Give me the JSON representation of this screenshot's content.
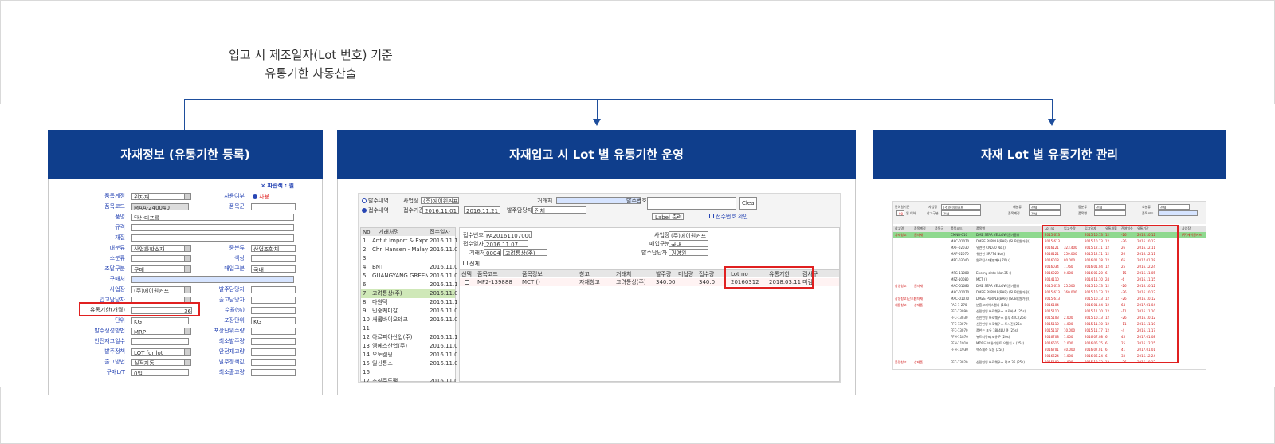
{
  "caption": {
    "line1": "입고 시 제조일자(Lot 번호) 기준",
    "line2": "유통기한 자동산출"
  },
  "panels": [
    {
      "title": "자재정보 (유통기한 등록)"
    },
    {
      "title": "자재입고 시 Lot 별 유통기한 운영"
    },
    {
      "title": "자재 Lot 별 유통기한 관리"
    }
  ],
  "material_form": {
    "top_link": "× 파란색 : 필",
    "rows": [
      {
        "label": "품목계정",
        "value": "원자재",
        "right_label": "사용여부",
        "right_value": "사용"
      },
      {
        "label": "품목코드",
        "value": "MAA-240040",
        "right_label": "품목군",
        "right_value": ""
      },
      {
        "label": "품명",
        "value": "탄산디프롤",
        "right_label": "",
        "right_value": ""
      },
      {
        "label": "규격",
        "value": "",
        "right_label": "",
        "right_value": ""
      },
      {
        "label": "재질",
        "value": "",
        "right_label": "",
        "right_value": ""
      },
      {
        "label": "대분류",
        "value": "산업화학소재",
        "right_label": "중분류",
        "right_value": "산업조합체"
      },
      {
        "label": "소분류",
        "value": "",
        "right_label": "색상",
        "right_value": ""
      },
      {
        "label": "조달구분",
        "value": "구매",
        "right_label": "매입구분",
        "right_value": "국내"
      },
      {
        "label": "구매처",
        "value": "",
        "right_label": "",
        "right_value": ""
      },
      {
        "label": "사업장",
        "value": "(주)에이원커프",
        "right_label": "발주담당자",
        "right_value": ""
      },
      {
        "label": "입고담당자",
        "value": "",
        "right_label": "출고담당자",
        "right_value": ""
      },
      {
        "label": "유통기한(개월)",
        "value": "36",
        "right_label": "수율(%)",
        "right_value": ""
      },
      {
        "label": "단위",
        "value": "KG",
        "right_label": "포장단위",
        "right_value": "KG"
      },
      {
        "label": "발주생성방법",
        "value": "MRP",
        "right_label": "포장단위수량",
        "right_value": ""
      },
      {
        "label": "안전재고일수",
        "value": "",
        "right_label": "최소발주량",
        "right_value": ""
      },
      {
        "label": "발주정책",
        "value": "LOT for lot",
        "right_label": "안전재고량",
        "right_value": ""
      },
      {
        "label": "출고방법",
        "value": "실적자동",
        "right_label": "발주정책값",
        "right_value": ""
      },
      {
        "label": "구매L/T",
        "value": "0일",
        "right_label": "최소출고량",
        "right_value": ""
      }
    ]
  },
  "receipt_screen": {
    "filter": {
      "radio1": "발주내역",
      "radio2": "접수내역",
      "site_label": "사업장",
      "site_value": "(주)에이원커프",
      "period_label": "접수기간",
      "date_from": "2016.11.01",
      "date_to": "2016.11.21",
      "vendor_label": "거래처",
      "manager_label": "발주담당자",
      "manager_value": "전체",
      "order_no_label": "발주번호",
      "clear_button": "Clear",
      "label_button": "Label 출력",
      "confirm_check": "접수번호 확인"
    },
    "list_headers": [
      "No.",
      "거래처명",
      "접수일자"
    ],
    "list_rows": [
      {
        "no": "1",
        "name": "Anfut Import & Expo",
        "date": "2016.11.10"
      },
      {
        "no": "2",
        "name": "Chr. Hansen - Malay",
        "date": "2016.11.02"
      },
      {
        "no": "3",
        "name": "",
        "date": ""
      },
      {
        "no": "4",
        "name": "BNT",
        "date": "2016.11.02"
      },
      {
        "no": "5",
        "name": "GUANGYANG GREEN SEA",
        "date": "2016.11.01"
      },
      {
        "no": "6",
        "name": "",
        "date": "2016.11.14"
      },
      {
        "no": "7",
        "name": "고려통상(주)",
        "date": "2016.11.07"
      },
      {
        "no": "8",
        "name": "다원텍",
        "date": "2016.11.11"
      },
      {
        "no": "9",
        "name": "민중케미칼",
        "date": "2016.11.07"
      },
      {
        "no": "10",
        "name": "새롬바이오테크",
        "date": "2016.11.09"
      },
      {
        "no": "11",
        "name": "",
        "date": ""
      },
      {
        "no": "12",
        "name": "아르피아산업(주)",
        "date": "2016.11.11"
      },
      {
        "no": "13",
        "name": "엠에스산업(주)",
        "date": "2016.11.03"
      },
      {
        "no": "14",
        "name": "오토캠핑",
        "date": "2016.11.01"
      },
      {
        "no": "15",
        "name": "일신통스",
        "date": "2016.11.07"
      },
      {
        "no": "16",
        "name": "",
        "date": ""
      },
      {
        "no": "17",
        "name": "조성주도팩",
        "date": "2016.11.04"
      }
    ],
    "detail": {
      "receipt_no_label": "접수번호",
      "receipt_no": "PA2016110700001",
      "date_label": "접수일자",
      "date": "2016.11.07",
      "vendor_label": "거래처",
      "vendor_code": "00042",
      "vendor_name": "고려통상(주)",
      "site_label": "사업장",
      "site": "(주)에이원커프",
      "buy_type_label": "매입구분",
      "buy_type": "국내",
      "manager_label": "발주담당자",
      "manager": "권영원",
      "all_check": "전체"
    },
    "grid_headers": [
      "선택",
      "품목코드",
      "품목정보",
      "창고",
      "거래처",
      "발주량",
      "미납량",
      "접수량",
      "Lot no",
      "유통기한",
      "검사구"
    ],
    "grid_row": {
      "code": "MF2-139888",
      "info": "MCT ()",
      "warehouse": "자재창고",
      "vendor": "고려통상(주)",
      "order_qty": "340.00",
      "recv_qty": "340.0",
      "lot": "20160312",
      "expiry": "2018.03.11",
      "inspect": "미검"
    }
  },
  "lot_screen": {
    "filter": {
      "expiry_label": "잔여일기준",
      "expiry_value": "90",
      "expiry_suffix": "일 이하",
      "site_label": "사업장",
      "site_value": "(주)에이원커프",
      "warehouse_label": "창고구분",
      "warehouse_value": "전체",
      "acct_label": "대분류",
      "acct_value": "전체",
      "mid_label": "중분류",
      "mid_value": "전체",
      "small_label": "소분류",
      "small_value": "전체",
      "status_label": "품목계정",
      "status_value": "전체",
      "name_label": "품목명",
      "code_label": "품목코드"
    },
    "headers": [
      "창고명",
      "품목계정",
      "품목군",
      "품목코드",
      "품목명",
      "Lot no",
      "입고수량",
      "입고일자",
      "유통개월",
      "잔여일수",
      "유통기간",
      "사업장"
    ],
    "rows": [
      {
        "wh": "자재창고",
        "acct": "원자재",
        "code": "CMNB-010",
        "name": "DMZ STAR YELLOW(원가용()",
        "lot": "2015.613",
        "qty": "",
        "date": "2015.10.13",
        "mon": "12",
        "rem": "-26",
        "exp": "2016.10.12",
        "site": "(주)에이원커프",
        "hl": true
      },
      {
        "wh": "",
        "acct": "",
        "code": "MAC-01070",
        "name": "DMZE PURPLE(BAR) (SUB)(원가용()",
        "lot": "2015.613",
        "qty": "",
        "date": "2015.10.13",
        "mon": "12",
        "rem": "-26",
        "exp": "2016.10.12",
        "site": ""
      },
      {
        "wh": "",
        "acct": "",
        "code": "MAF-02030",
        "name": "유연한 CN070 No.()",
        "lot": "2016121",
        "qty": "323.400",
        "date": "2015.12.11",
        "mon": "12",
        "rem": "26",
        "exp": "2016.12.11",
        "site": ""
      },
      {
        "wh": "",
        "acct": "",
        "code": "MAF-02070",
        "name": "유연한 SR774 No.()",
        "lot": "2016121",
        "qty": "250.000",
        "date": "2015.12.11",
        "mon": "12",
        "rem": "26",
        "exp": "2016.12.11",
        "site": ""
      },
      {
        "wh": "",
        "acct": "",
        "code": "MFC-03040",
        "name": "원료팀소재(판매사 70).()",
        "lot": "2016018",
        "qty": "80.000",
        "date": "2016.01.28",
        "mon": "12",
        "rem": "65",
        "exp": "2017.01.28",
        "site": ""
      },
      {
        "wh": "",
        "acct": "",
        "code": "",
        "name": "",
        "lot": "2016034",
        "qty": "7.760",
        "date": "2016.01.04",
        "mon": "12",
        "rem": "25",
        "exp": "2016.12.24",
        "site": ""
      },
      {
        "wh": "",
        "acct": "",
        "code": "MFG-11080",
        "name": "Enerny slrde blar.35 ()",
        "lot": "2016020",
        "qty": "0.000",
        "date": "2016.05.20",
        "mon": "6",
        "rem": "-15",
        "exp": "2016.11.05",
        "site": ""
      },
      {
        "wh": "",
        "acct": "",
        "code": "MFZ-10080",
        "name": "MCT ()",
        "lot": "2014110",
        "qty": "",
        "date": "2014.11.10",
        "mon": "24",
        "rem": "-6",
        "exp": "2016.11.15",
        "site": ""
      },
      {
        "wh": "상생창고",
        "acct": "원자재",
        "code": "MAC-01080",
        "name": "DMZ STAR YELLOW(원가용()",
        "lot": "2015.613",
        "qty": "25.000",
        "date": "2015.10.13",
        "mon": "12",
        "rem": "-26",
        "exp": "2016.10.12",
        "site": ""
      },
      {
        "wh": "",
        "acct": "",
        "code": "MAC-01070",
        "name": "DMZE PURPLE(BAR) (SUB)(원가용()",
        "lot": "2015.613",
        "qty": "160.000",
        "date": "2015.10.13",
        "mon": "12",
        "rem": "-26",
        "exp": "2016.10.12",
        "site": ""
      },
      {
        "wh": "상생창고(단조)",
        "acct": "원자재",
        "code": "MAC-01070",
        "name": "DMZE PURPLE(BAR) (SUB)(원가용()",
        "lot": "2015.613",
        "qty": "",
        "date": "2015.10.13",
        "mon": "12",
        "rem": "-26",
        "exp": "2016.10.12",
        "site": ""
      },
      {
        "wh": "제품창고",
        "acct": "상제품",
        "code": "FAC-1-270",
        "name": "분홍고레이스젤리 (10s)",
        "lot": "2016104",
        "qty": "",
        "date": "2016.01.04",
        "mon": "12",
        "rem": "64",
        "exp": "2017.01.04",
        "site": ""
      },
      {
        "wh": "",
        "acct": "",
        "code": "FFC-13090",
        "name": "신민인영 바로웨우스 크로바 4 (25s)",
        "lot": "2015110",
        "qty": "",
        "date": "2015.11.10",
        "mon": "12",
        "rem": "-11",
        "exp": "2016.11.10",
        "site": ""
      },
      {
        "wh": "",
        "acct": "",
        "code": "FFC-13030",
        "name": "신민인영 바로웨우스 블루 4TC (25s)",
        "lot": "2015103",
        "qty": "2.000",
        "date": "2015.10.13",
        "mon": "12",
        "rem": "-26",
        "exp": "2016.10.12",
        "site": ""
      },
      {
        "wh": "",
        "acct": "",
        "code": "FFC-13070",
        "name": "신민인영 바로웨우스 투시진 (25s)",
        "lot": "2015110",
        "qty": "4.000",
        "date": "2015.11.10",
        "mon": "12",
        "rem": "-11",
        "exp": "2016.11.10",
        "site": ""
      },
      {
        "wh": "",
        "acct": "",
        "code": "FFC-13070",
        "name": "품한는 포유 18L4LU 큐 (25s)",
        "lot": "2015117",
        "qty": "10.000",
        "date": "2015.11.17",
        "mon": "12",
        "rem": "-4",
        "exp": "2016.11.17",
        "site": ""
      },
      {
        "wh": "",
        "acct": "",
        "code": "FFH-11870",
        "name": "뉴트리쿠씨 포유 P (20s)",
        "lot": "2016708",
        "qty": "1.000",
        "date": "2016.07.08",
        "mon": "6",
        "rem": "45",
        "exp": "2017.01.08",
        "site": ""
      },
      {
        "wh": "",
        "acct": "",
        "code": "FFH-11910",
        "name": "MDS도 브릴리언트 오렌지 4 (25s)",
        "lot": "2016615",
        "qty": "2.000",
        "date": "2016.06.15",
        "mon": "6",
        "rem": "25",
        "exp": "2016.12.15",
        "site": ""
      },
      {
        "wh": "",
        "acct": "",
        "code": "FFH-11930",
        "name": "엑스페라 오동 (25s)",
        "lot": "2016701",
        "qty": "40.000",
        "date": "2016.07.01",
        "mon": "6",
        "rem": "41",
        "exp": "2017.01.01",
        "site": ""
      },
      {
        "wh": "",
        "acct": "",
        "code": "",
        "name": "",
        "lot": "2016624",
        "qty": "1.000",
        "date": "2016.06.24",
        "mon": "6",
        "rem": "33",
        "exp": "2016.12.24",
        "site": ""
      },
      {
        "wh": "불량창고",
        "acct": "상제품",
        "code": "FFC-13020",
        "name": "신민인영 바로웨우스 덕조 35 (25s)",
        "lot": "2015103",
        "qty": "4.000",
        "date": "2015.10.13",
        "mon": "12",
        "rem": "-26",
        "exp": "2016.10.12",
        "site": ""
      }
    ]
  },
  "colors": {
    "header_blue": "#0f3e8c",
    "connector_blue": "#1e4e9c",
    "highlight_red": "#e02020"
  }
}
